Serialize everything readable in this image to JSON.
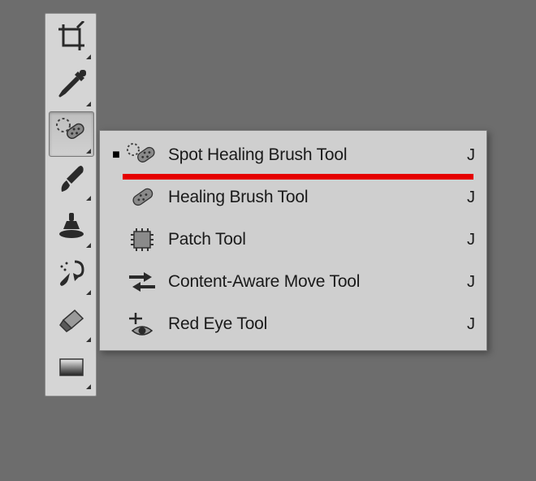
{
  "toolbar": {
    "tools": [
      {
        "name": "crop",
        "active": false
      },
      {
        "name": "eyedropper",
        "active": false
      },
      {
        "name": "spot-healing-brush",
        "active": true
      },
      {
        "name": "brush",
        "active": false
      },
      {
        "name": "clone-stamp",
        "active": false
      },
      {
        "name": "history-brush",
        "active": false
      },
      {
        "name": "eraser",
        "active": false
      },
      {
        "name": "gradient",
        "active": false
      }
    ]
  },
  "flyout": {
    "items": [
      {
        "label": "Spot Healing Brush Tool",
        "shortcut": "J",
        "selected": true,
        "highlighted": true,
        "icon": "spot-healing-brush"
      },
      {
        "label": "Healing Brush Tool",
        "shortcut": "J",
        "selected": false,
        "highlighted": false,
        "icon": "healing-brush"
      },
      {
        "label": "Patch Tool",
        "shortcut": "J",
        "selected": false,
        "highlighted": false,
        "icon": "patch"
      },
      {
        "label": "Content-Aware Move Tool",
        "shortcut": "J",
        "selected": false,
        "highlighted": false,
        "icon": "content-aware-move"
      },
      {
        "label": "Red Eye Tool",
        "shortcut": "J",
        "selected": false,
        "highlighted": false,
        "icon": "red-eye"
      }
    ]
  }
}
